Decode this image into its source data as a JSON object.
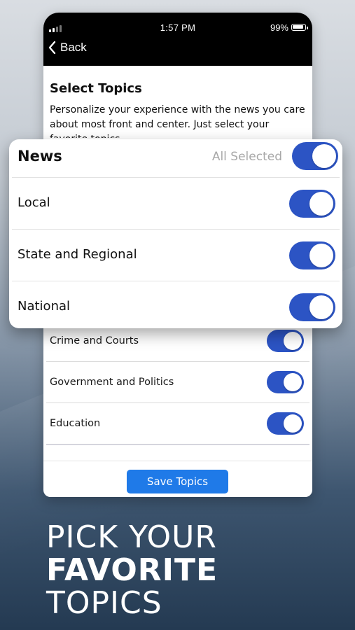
{
  "status_bar": {
    "time": "1:57 PM",
    "battery": "99%"
  },
  "nav": {
    "back_label": "Back"
  },
  "page": {
    "title": "Select Topics",
    "description": "Personalize your experience with the news you care about most front and center. Just select your favorite topics"
  },
  "news_card": {
    "title": "News",
    "all_selected_label": "All Selected",
    "items": [
      {
        "label": "Local",
        "enabled": true
      },
      {
        "label": "State and Regional",
        "enabled": true
      },
      {
        "label": "National",
        "enabled": true
      }
    ]
  },
  "topics": [
    {
      "label": "Crime and Courts",
      "enabled": true
    },
    {
      "label": "Government and Politics",
      "enabled": true
    },
    {
      "label": "Education",
      "enabled": true
    }
  ],
  "save_button": "Save Topics",
  "headline": {
    "line1": "PICK YOUR",
    "line2": "FAVORITE",
    "line3": "TOPICS"
  },
  "colors": {
    "toggle_on": "#2c54c4",
    "save_button": "#1f7ae8",
    "status_bar": "#000000"
  }
}
